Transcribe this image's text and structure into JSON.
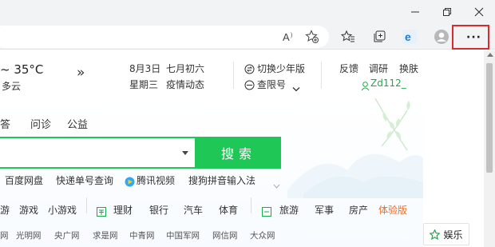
{
  "browser": {
    "window_controls": [
      "−",
      "❐",
      "✕"
    ],
    "toolbar_icons": [
      "read-aloud-icon",
      "add-favorite-icon",
      "favorites-icon",
      "collections-icon",
      "edge-icon",
      "profile-icon"
    ],
    "more_label": "···",
    "highlight_color": "#d92b2b"
  },
  "weather": {
    "temp": "~ 35°C",
    "condition": "多云"
  },
  "date": {
    "solar": "8月3日",
    "weekday": "星期三",
    "lunar": "七月初六",
    "news": "疫情动态"
  },
  "mode": {
    "switch_label": "切换少年版",
    "query_label": "查限号"
  },
  "userbar": {
    "feedback": "反馈",
    "survey": "调研",
    "skin": "换肤",
    "user": "Zd112_"
  },
  "search_tabs": [
    "答",
    "问诊",
    "公益"
  ],
  "search": {
    "button": "搜索",
    "accent": "#1fc756"
  },
  "quick_links": [
    "百度网盘",
    "快递单号查询",
    "腾讯视频",
    "搜狗拼音输入法"
  ],
  "categories": [
    {
      "label": "游",
      "type": "plain"
    },
    {
      "label": "游戏",
      "type": "plain"
    },
    {
      "label": "小游戏",
      "type": "plain"
    },
    {
      "label": "理财",
      "type": "icon"
    },
    {
      "label": "银行",
      "type": "plain"
    },
    {
      "label": "汽车",
      "type": "plain"
    },
    {
      "label": "体育",
      "type": "plain"
    },
    {
      "label": "旅游",
      "type": "icon"
    },
    {
      "label": "军事",
      "type": "plain"
    },
    {
      "label": "房产",
      "type": "plain"
    },
    {
      "label": "体验版",
      "type": "highlight"
    }
  ],
  "news_sites": [
    "网",
    "光明网",
    "央广网",
    "求是网",
    "中青网",
    "中国军网",
    "网信网",
    "大众网"
  ],
  "entertainment": "娱乐"
}
